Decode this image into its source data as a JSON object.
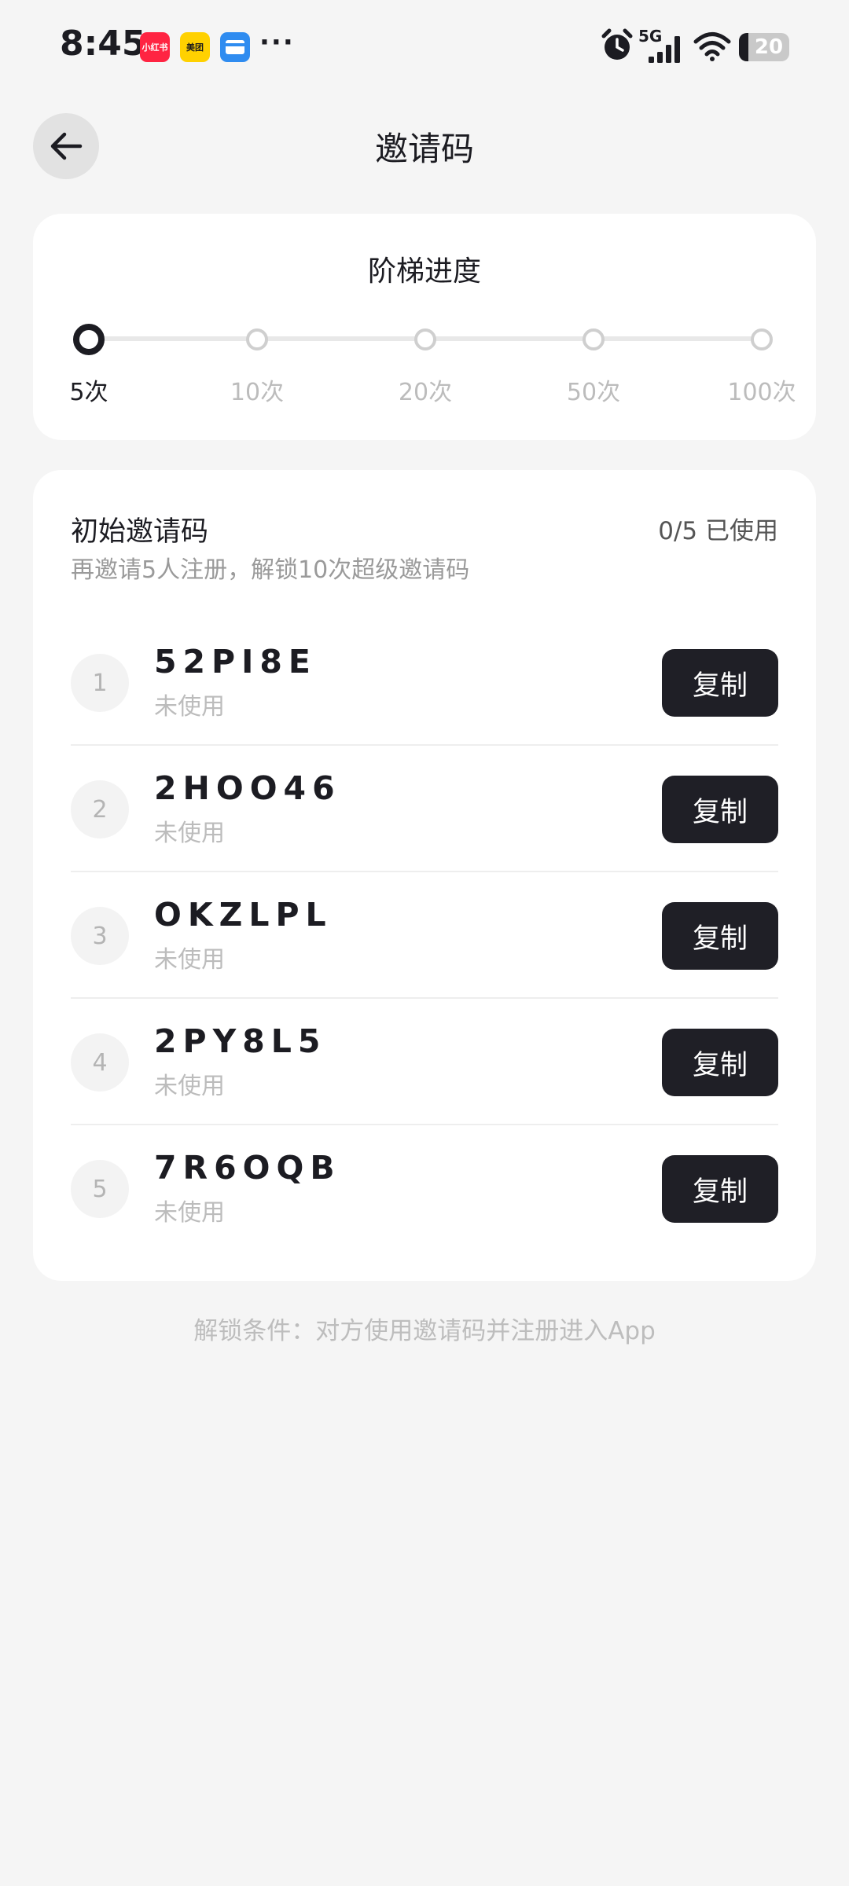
{
  "status_bar": {
    "time": "8:45",
    "apps": [
      {
        "label": "小红书",
        "color": "#ff2442"
      },
      {
        "label": "美团",
        "color": "#ffd100"
      },
      {
        "label": "",
        "color": "#2f8cf0"
      }
    ],
    "more": "···",
    "network": "5G",
    "battery": "20",
    "icons": [
      "alarm-icon",
      "signal-icon",
      "wifi-icon",
      "battery-icon"
    ]
  },
  "header": {
    "back_icon": "arrow-left-icon",
    "title": "邀请码"
  },
  "ladder": {
    "title": "阶梯进度",
    "steps": [
      {
        "label": "5次",
        "active": true
      },
      {
        "label": "10次",
        "active": false
      },
      {
        "label": "20次",
        "active": false
      },
      {
        "label": "50次",
        "active": false
      },
      {
        "label": "100次",
        "active": false
      }
    ]
  },
  "codes_section": {
    "title": "初始邀请码",
    "usage": "0/5 已使用",
    "subtitle": "再邀请5人注册，解锁10次超级邀请码",
    "items": [
      {
        "index": "1",
        "code": "52PI8E",
        "status": "未使用",
        "button": "复制"
      },
      {
        "index": "2",
        "code": "2HOO46",
        "status": "未使用",
        "button": "复制"
      },
      {
        "index": "3",
        "code": "OKZLPL",
        "status": "未使用",
        "button": "复制"
      },
      {
        "index": "4",
        "code": "2PY8L5",
        "status": "未使用",
        "button": "复制"
      },
      {
        "index": "5",
        "code": "7R6OQB",
        "status": "未使用",
        "button": "复制"
      }
    ]
  },
  "footer": {
    "note": "解锁条件：对方使用邀请码并注册进入App"
  },
  "colors": {
    "background": "#f5f5f5",
    "card": "#ffffff",
    "primary_button": "#1f1f26",
    "muted_text": "#bcbcbc"
  }
}
